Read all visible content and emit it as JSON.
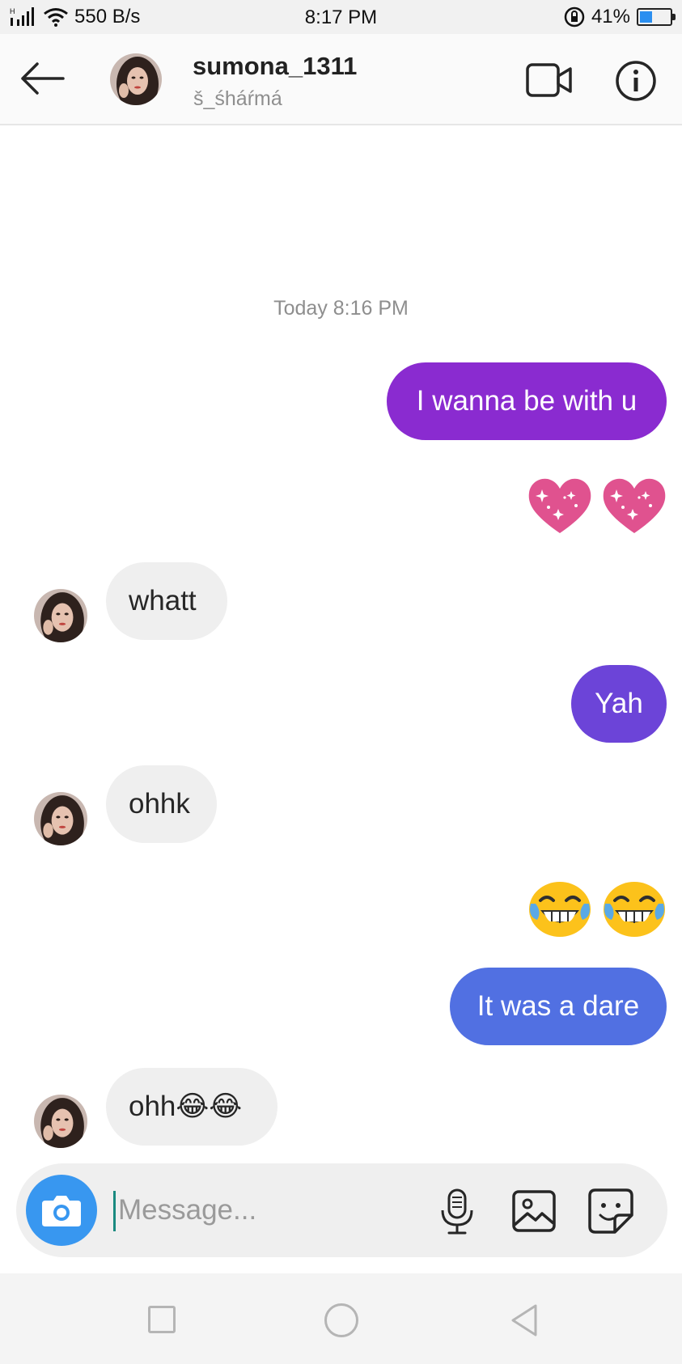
{
  "status_bar": {
    "network_speed": "550 B/s",
    "time": "8:17 PM",
    "battery_percent": "41%",
    "battery_level": 0.41
  },
  "header": {
    "username": "sumona_1311",
    "full_name": "š_śháŕmá"
  },
  "chat": {
    "timestamp": "Today 8:16 PM",
    "messages": [
      {
        "direction": "outgoing",
        "text": "I wanna be with u",
        "color": "#8a2bd0"
      },
      {
        "direction": "outgoing",
        "text": "💖💖",
        "color": ""
      },
      {
        "direction": "incoming",
        "text": "whatt",
        "color": "#efefef"
      },
      {
        "direction": "outgoing",
        "text": "Yah",
        "color": "#6c44d8"
      },
      {
        "direction": "incoming",
        "text": "ohhk",
        "color": "#efefef"
      },
      {
        "direction": "outgoing",
        "text": "😂😂",
        "color": ""
      },
      {
        "direction": "outgoing",
        "text": "It was a dare",
        "color": "#5170e2"
      },
      {
        "direction": "incoming",
        "text": "ohh😂😂",
        "color": "#efefef"
      }
    ]
  },
  "composer": {
    "placeholder": "Message..."
  },
  "icons": {
    "back": "arrow-left-icon",
    "video_call": "video-camera-icon",
    "info": "info-icon",
    "camera": "camera-icon",
    "microphone": "microphone-icon",
    "gallery": "image-icon",
    "sticker": "sticker-icon"
  },
  "colors": {
    "accent_blue": "#3897f0",
    "bubble_purple": "#8a2bd0",
    "bubble_violet": "#6c44d8",
    "bubble_blue": "#5170e2",
    "incoming_bubble": "#efefef"
  }
}
